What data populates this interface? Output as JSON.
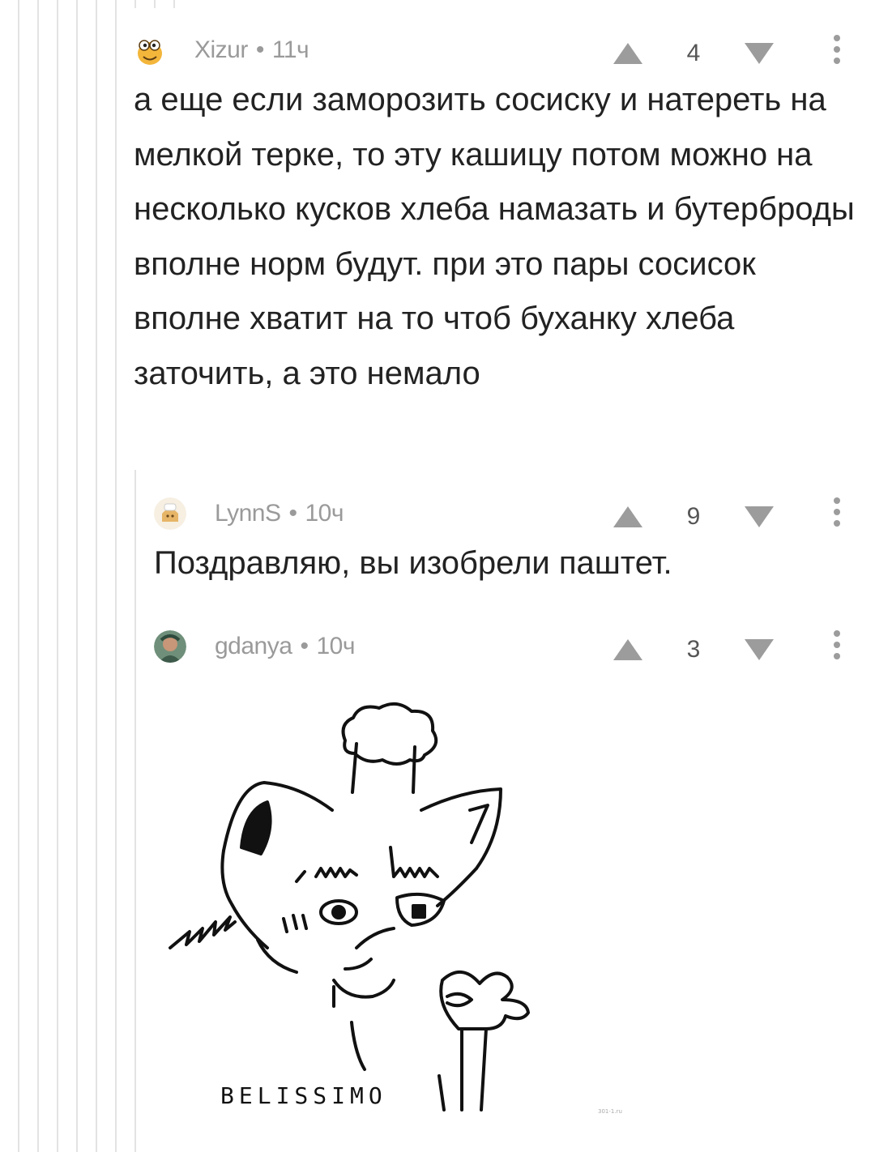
{
  "comments": [
    {
      "author": "Xizur",
      "time": "11ч",
      "score": "4",
      "text": "а еще если заморозить сосиску и натереть на мелкой терке, то эту кашицу потом можно на несколько кусков хлеба намазать и бутерброды вполне норм будут. при это пары сосисок вполне хватит на то чтоб буханку хлеба заточить, а это немало"
    },
    {
      "author": "LynnS",
      "time": "10ч",
      "score": "9",
      "text": "Поздравляю, вы изобрели паштет."
    },
    {
      "author": "gdanya",
      "time": "10ч",
      "score": "3",
      "image_caption": "BELISSIMO",
      "image_watermark": "301-1.ru"
    }
  ],
  "separator": "•",
  "colors": {
    "meta": "#9a9a9a",
    "text": "#222222",
    "icon": "#9c9c9c",
    "thread_line": "#e3e3e3"
  },
  "icons": [
    "upvote-arrow-icon",
    "downvote-arrow-icon",
    "more-vertical-icon"
  ]
}
